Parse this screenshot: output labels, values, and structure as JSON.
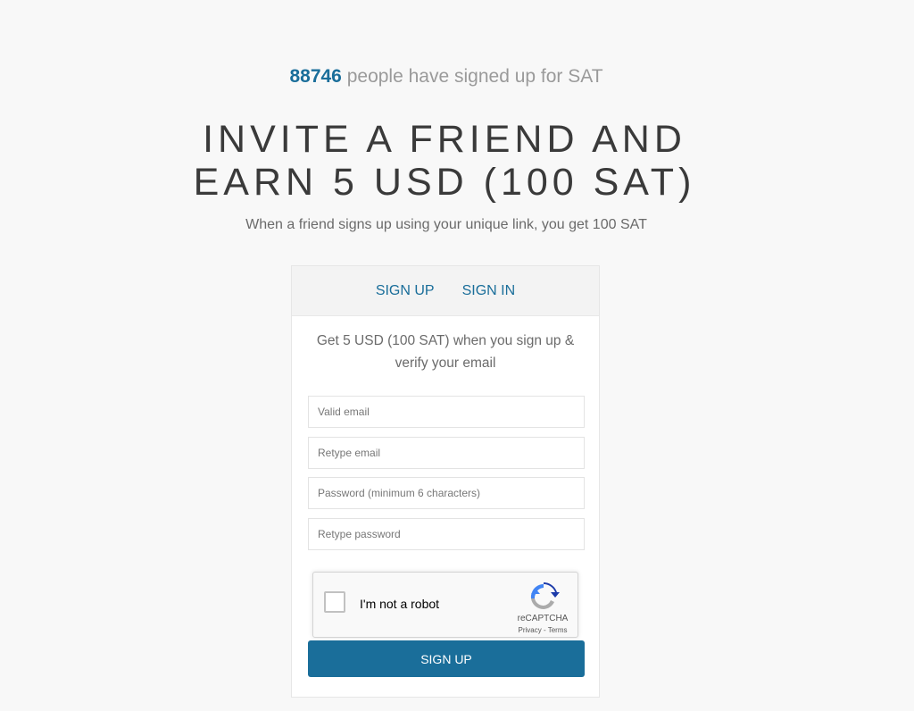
{
  "stats": {
    "count": "88746",
    "text": "people have signed up for SAT"
  },
  "headline": {
    "line1": "INVITE A FRIEND AND",
    "line2": "EARN 5 USD (100 SAT)"
  },
  "subheadline": "When a friend signs up using your unique link, you get 100 SAT",
  "tabs": [
    {
      "label": "SIGN UP"
    },
    {
      "label": "SIGN IN"
    }
  ],
  "promo_text": "Get 5 USD (100 SAT) when you sign up & verify your email",
  "form": {
    "email_placeholder": "Valid email",
    "retype_email_placeholder": "Retype email",
    "password_placeholder": "Password (minimum 6 characters)",
    "retype_password_placeholder": "Retype password",
    "submit_label": "SIGN UP"
  },
  "recaptcha": {
    "label": "I'm not a robot",
    "brand": "reCAPTCHA",
    "privacy": "Privacy",
    "separator": " - ",
    "terms": "Terms"
  },
  "colors": {
    "accent": "#1a6e9a",
    "background": "#f8f8f8"
  }
}
